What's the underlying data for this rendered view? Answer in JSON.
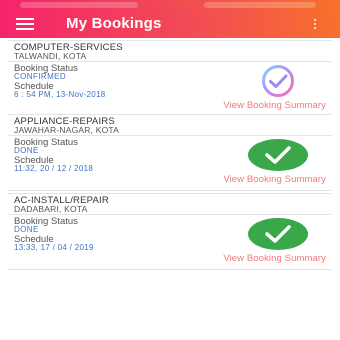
{
  "header": {
    "title": "My Bookings",
    "menu_icon": "hamburger-menu-icon",
    "more_icon": "more-vertical-icon"
  },
  "colors": {
    "header_start": "#f5246a",
    "header_end": "#f7702c",
    "status_blue": "#3d72c4",
    "link": "#f37777",
    "done_green": "#3aa84a"
  },
  "labels": {
    "booking_status": "Booking Status",
    "schedule": "Schedule",
    "view_summary": "View Booking Summary"
  },
  "bookings": [
    {
      "service": "COMPUTER-SERVICES",
      "location": "TALWANDI, KOTA",
      "status": "CONFIRMED",
      "schedule": "6 : 54 PM, 13-Nov-2018",
      "icon": "gradient-check-circle-icon"
    },
    {
      "service": "APPLIANCE-REPAIRS",
      "location": "JAWAHAR-NAGAR, KOTA",
      "status": "DONE",
      "schedule": "11:32, 20 / 12 / 2018",
      "icon": "green-check-badge-icon"
    },
    {
      "service": "AC-INSTALL/REPAIR",
      "location": "DADABARI, KOTA",
      "status": "DONE",
      "schedule": "13:33, 17 / 04 / 2019",
      "icon": "green-check-badge-icon"
    }
  ]
}
